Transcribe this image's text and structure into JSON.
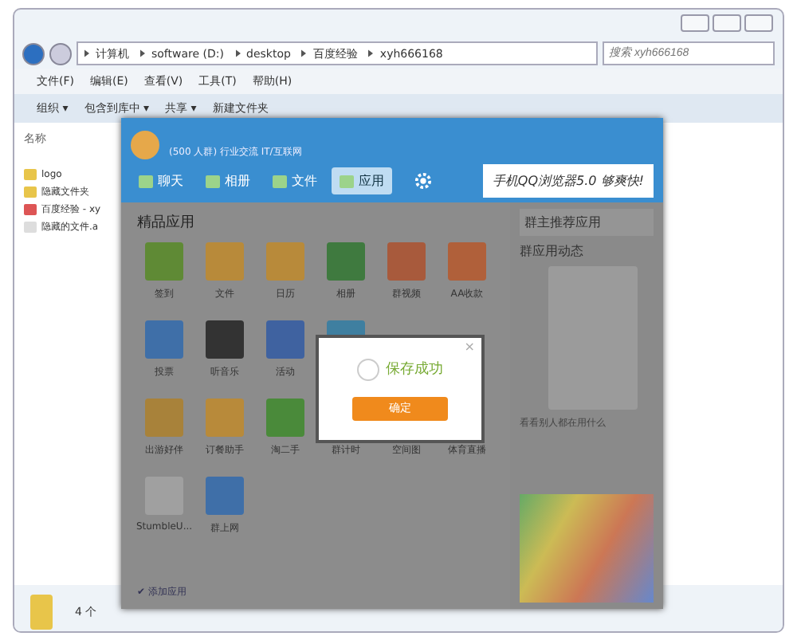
{
  "explorer": {
    "address": [
      "计算机",
      "software (D:)",
      "desktop",
      "百度经验",
      "xyh666168"
    ],
    "search": {
      "placeholder": "搜索 xyh666168"
    },
    "menu": [
      "文件(F)",
      "编辑(E)",
      "查看(V)",
      "工具(T)",
      "帮助(H)"
    ],
    "toolbar": [
      "组织 ▾",
      "包含到库中 ▾",
      "共享 ▾",
      "新建文件夹"
    ],
    "column": "名称",
    "files": [
      {
        "name": "logo",
        "kind": "folder"
      },
      {
        "name": "隐藏文件夹",
        "kind": "folder"
      },
      {
        "name": "百度经验 - xy",
        "kind": "web"
      },
      {
        "name": "隐藏的文件.a",
        "kind": "file"
      }
    ],
    "status": "4 个"
  },
  "group": {
    "info": "(500 人群) 行业交流 IT/互联网",
    "tabs": [
      {
        "label": "聊天",
        "selected": false
      },
      {
        "label": "相册",
        "selected": false
      },
      {
        "label": "文件",
        "selected": false
      },
      {
        "label": "应用",
        "selected": true
      }
    ],
    "banner": "手机QQ浏览器5.0 够爽快!",
    "section": "精品应用",
    "app_rows": [
      [
        {
          "label": "签到",
          "color": "#5f8a35"
        },
        {
          "label": "文件",
          "color": "#b88a3a"
        },
        {
          "label": "日历",
          "color": "#b88a3a"
        },
        {
          "label": "相册",
          "color": "#3f7a3f"
        },
        {
          "label": "群视频",
          "color": "#a85a3c"
        },
        {
          "label": "AA收款",
          "color": "#b0603a"
        }
      ],
      [
        {
          "label": "投票",
          "color": "#3f6fa8"
        },
        {
          "label": "听音乐",
          "color": "#333333"
        },
        {
          "label": "活动",
          "color": "#3f62a0"
        },
        {
          "color": "#3f7fa0"
        }
      ],
      [
        {
          "label": "出游好伴",
          "color": "#a8823a"
        },
        {
          "label": "订餐助手",
          "color": "#b88a3a"
        },
        {
          "label": "淘二手",
          "color": "#4a8a3a"
        },
        {
          "label": "群计时"
        },
        {
          "label": "空间图"
        },
        {
          "label": "体育直播"
        }
      ],
      [
        {
          "label": "StumbleU...",
          "color": "#a0a0a0"
        },
        {
          "label": "群上网",
          "color": "#3f6fa8"
        }
      ]
    ],
    "side_title": "群主推荐应用",
    "side_sub": "群应用动态",
    "side_note": "看看别人都在用什么",
    "add_link": "✔ 添加应用"
  },
  "dialog": {
    "message": "保存成功",
    "button": "确定",
    "close": "×"
  }
}
